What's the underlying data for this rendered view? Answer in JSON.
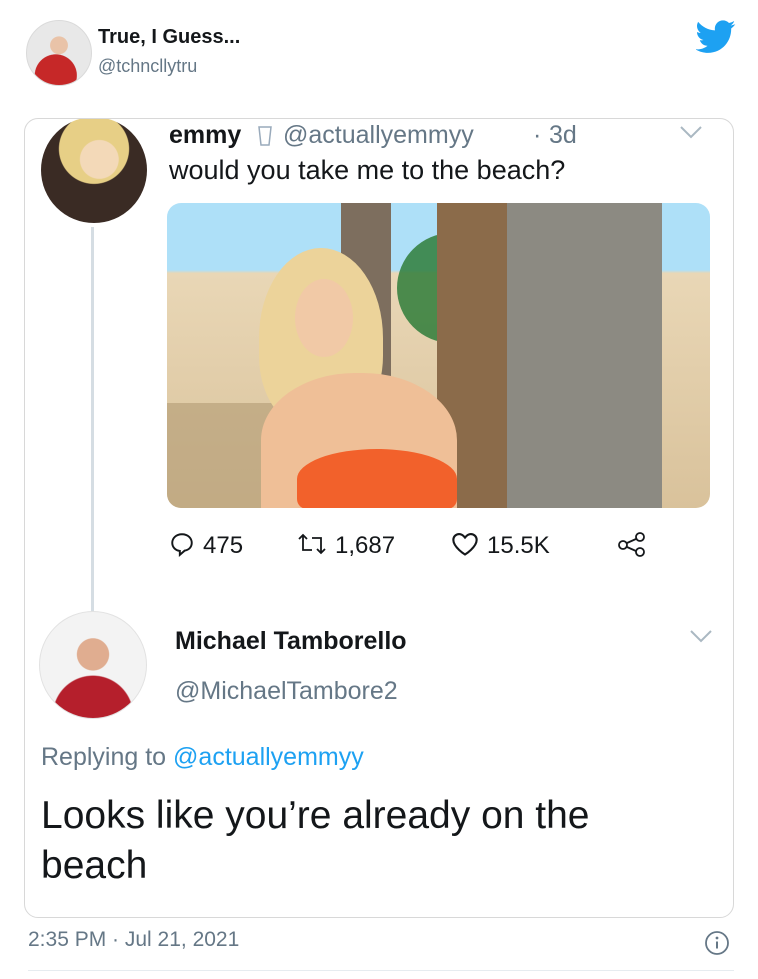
{
  "outer": {
    "name": "True, I Guess...",
    "handle": "@tchncllytru"
  },
  "emmy": {
    "name": "emmy",
    "handle": "@actuallyemmyy",
    "separator": "·",
    "time": "3d",
    "text": "would you take me to the beach?"
  },
  "stats": {
    "replies": "475",
    "retweets": "1,687",
    "likes": "15.5K"
  },
  "reply": {
    "name": "Michael Tamborello",
    "handle": "@MichaelTambore2",
    "replying_label": "Replying to",
    "replying_to": "@actuallyemmyy",
    "text": "Looks like you’re already on the beach"
  },
  "timestamp": "2:35 PM · Jul 21, 2021",
  "colors": {
    "twitter_blue": "#1DA1F2",
    "muted": "#657786",
    "text": "#14171A"
  },
  "icons": [
    "twitter-icon",
    "chevron-down-icon",
    "reply-icon",
    "retweet-icon",
    "like-icon",
    "share-icon",
    "info-icon"
  ]
}
